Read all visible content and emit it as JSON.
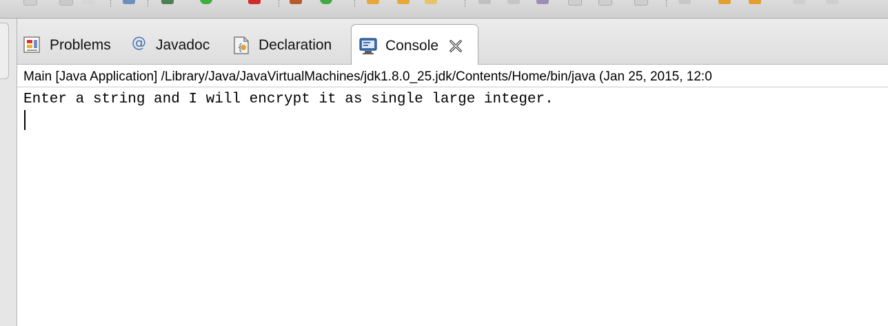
{
  "toolbar": {
    "icons": [
      "toolbar-icon",
      "toolbar-icon",
      "search-icon",
      "refresh-icon",
      "run-icon",
      "debug-icon",
      "tools-icon",
      "open-folder-icon",
      "open-folder-icon",
      "edit-icon",
      "nav-icon",
      "nav-icon",
      "arrow-left-icon",
      "arrow-right-icon"
    ]
  },
  "tabs": [
    {
      "label": "Problems",
      "icon": "problems-icon"
    },
    {
      "label": "Javadoc",
      "icon": "at-sign-icon",
      "glyph": "@"
    },
    {
      "label": "Declaration",
      "icon": "declaration-icon"
    },
    {
      "label": "Console",
      "icon": "console-icon",
      "active": true,
      "close_glyph": "✕"
    }
  ],
  "console": {
    "description": "Main [Java Application] /Library/Java/JavaVirtualMachines/jdk1.8.0_25.jdk/Contents/Home/bin/java (Jan 25, 2015, 12:0",
    "output": "Enter a string and I will encrypt it as single large integer."
  },
  "colors": {
    "accent_blue": "#3d6fb6",
    "tab_border": "#a8a8a8",
    "background": "#ffffff"
  }
}
